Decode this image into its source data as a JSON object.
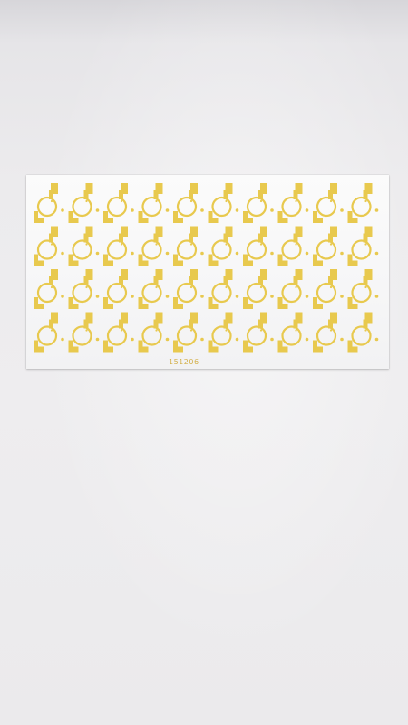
{
  "photo": {
    "subject_color": "#e8c94e",
    "substrate_color": "#f7f7f8",
    "background_color": "#ecebed"
  },
  "plate": {
    "rows": 4,
    "columns": 10,
    "marking": "151206"
  }
}
